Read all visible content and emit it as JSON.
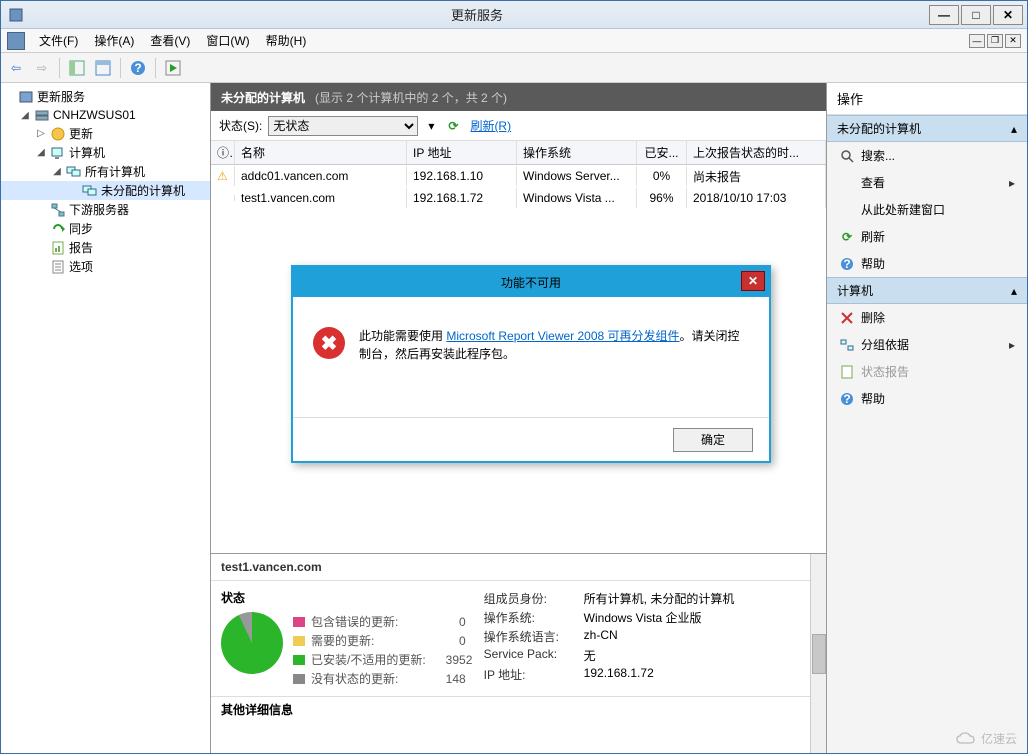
{
  "window": {
    "title": "更新服务"
  },
  "menu": {
    "file": "文件(F)",
    "action": "操作(A)",
    "view": "查看(V)",
    "window": "窗口(W)",
    "help": "帮助(H)"
  },
  "tree": {
    "root": "更新服务",
    "server": "CNHZWSUS01",
    "updates": "更新",
    "computers": "计算机",
    "all_computers": "所有计算机",
    "unassigned": "未分配的计算机",
    "downstream": "下游服务器",
    "sync": "同步",
    "report": "报告",
    "options": "选项"
  },
  "center": {
    "header_title": "未分配的计算机",
    "header_sub": "(显示 2 个计算机中的 2 个，共 2 个)",
    "state_label": "状态(S):",
    "state_value": "无状态",
    "refresh": "刷新(R)",
    "cols": {
      "name": "名称",
      "ip": "IP 地址",
      "os": "操作系统",
      "installed": "已安...",
      "last": "上次报告状态的时..."
    },
    "rows": [
      {
        "name": "addc01.vancen.com",
        "ip": "192.168.1.10",
        "os": "Windows Server...",
        "inst": "0%",
        "date": "尚未报告",
        "warn": true
      },
      {
        "name": "test1.vancen.com",
        "ip": "192.168.1.72",
        "os": "Windows Vista ...",
        "inst": "96%",
        "date": "2018/10/10 17:03",
        "warn": false
      }
    ]
  },
  "detail": {
    "title": "test1.vancen.com",
    "status_label": "状态",
    "legend": {
      "err": "包含错误的更新:",
      "need": "需要的更新:",
      "installed": "已安装/不适用的更新:",
      "nostate": "没有状态的更新:",
      "err_n": "0",
      "need_n": "0",
      "installed_n": "3952",
      "nostate_n": "148"
    },
    "info": {
      "member_label": "组成员身份:",
      "member_val": "所有计算机, 未分配的计算机",
      "os_label": "操作系统:",
      "os_val": "Windows Vista 企业版",
      "lang_label": "操作系统语言:",
      "lang_val": "zh-CN",
      "sp_label": "Service Pack:",
      "sp_val": "无",
      "ip_label": "IP 地址:",
      "ip_val": "192.168.1.72"
    },
    "other": "其他详细信息"
  },
  "actions": {
    "title": "操作",
    "section1": "未分配的计算机",
    "search": "搜索...",
    "view": "查看",
    "new_window": "从此处新建窗口",
    "refresh": "刷新",
    "help": "帮助",
    "section2": "计算机",
    "delete": "删除",
    "group": "分组依据",
    "status_report": "状态报告",
    "help2": "帮助"
  },
  "modal": {
    "title": "功能不可用",
    "text1": "此功能需要使用 ",
    "link": "Microsoft Report Viewer 2008 可再分发组件",
    "text2": "。请关闭控制台，然后再安装此程序包。",
    "ok": "确定"
  },
  "watermark": "亿速云"
}
